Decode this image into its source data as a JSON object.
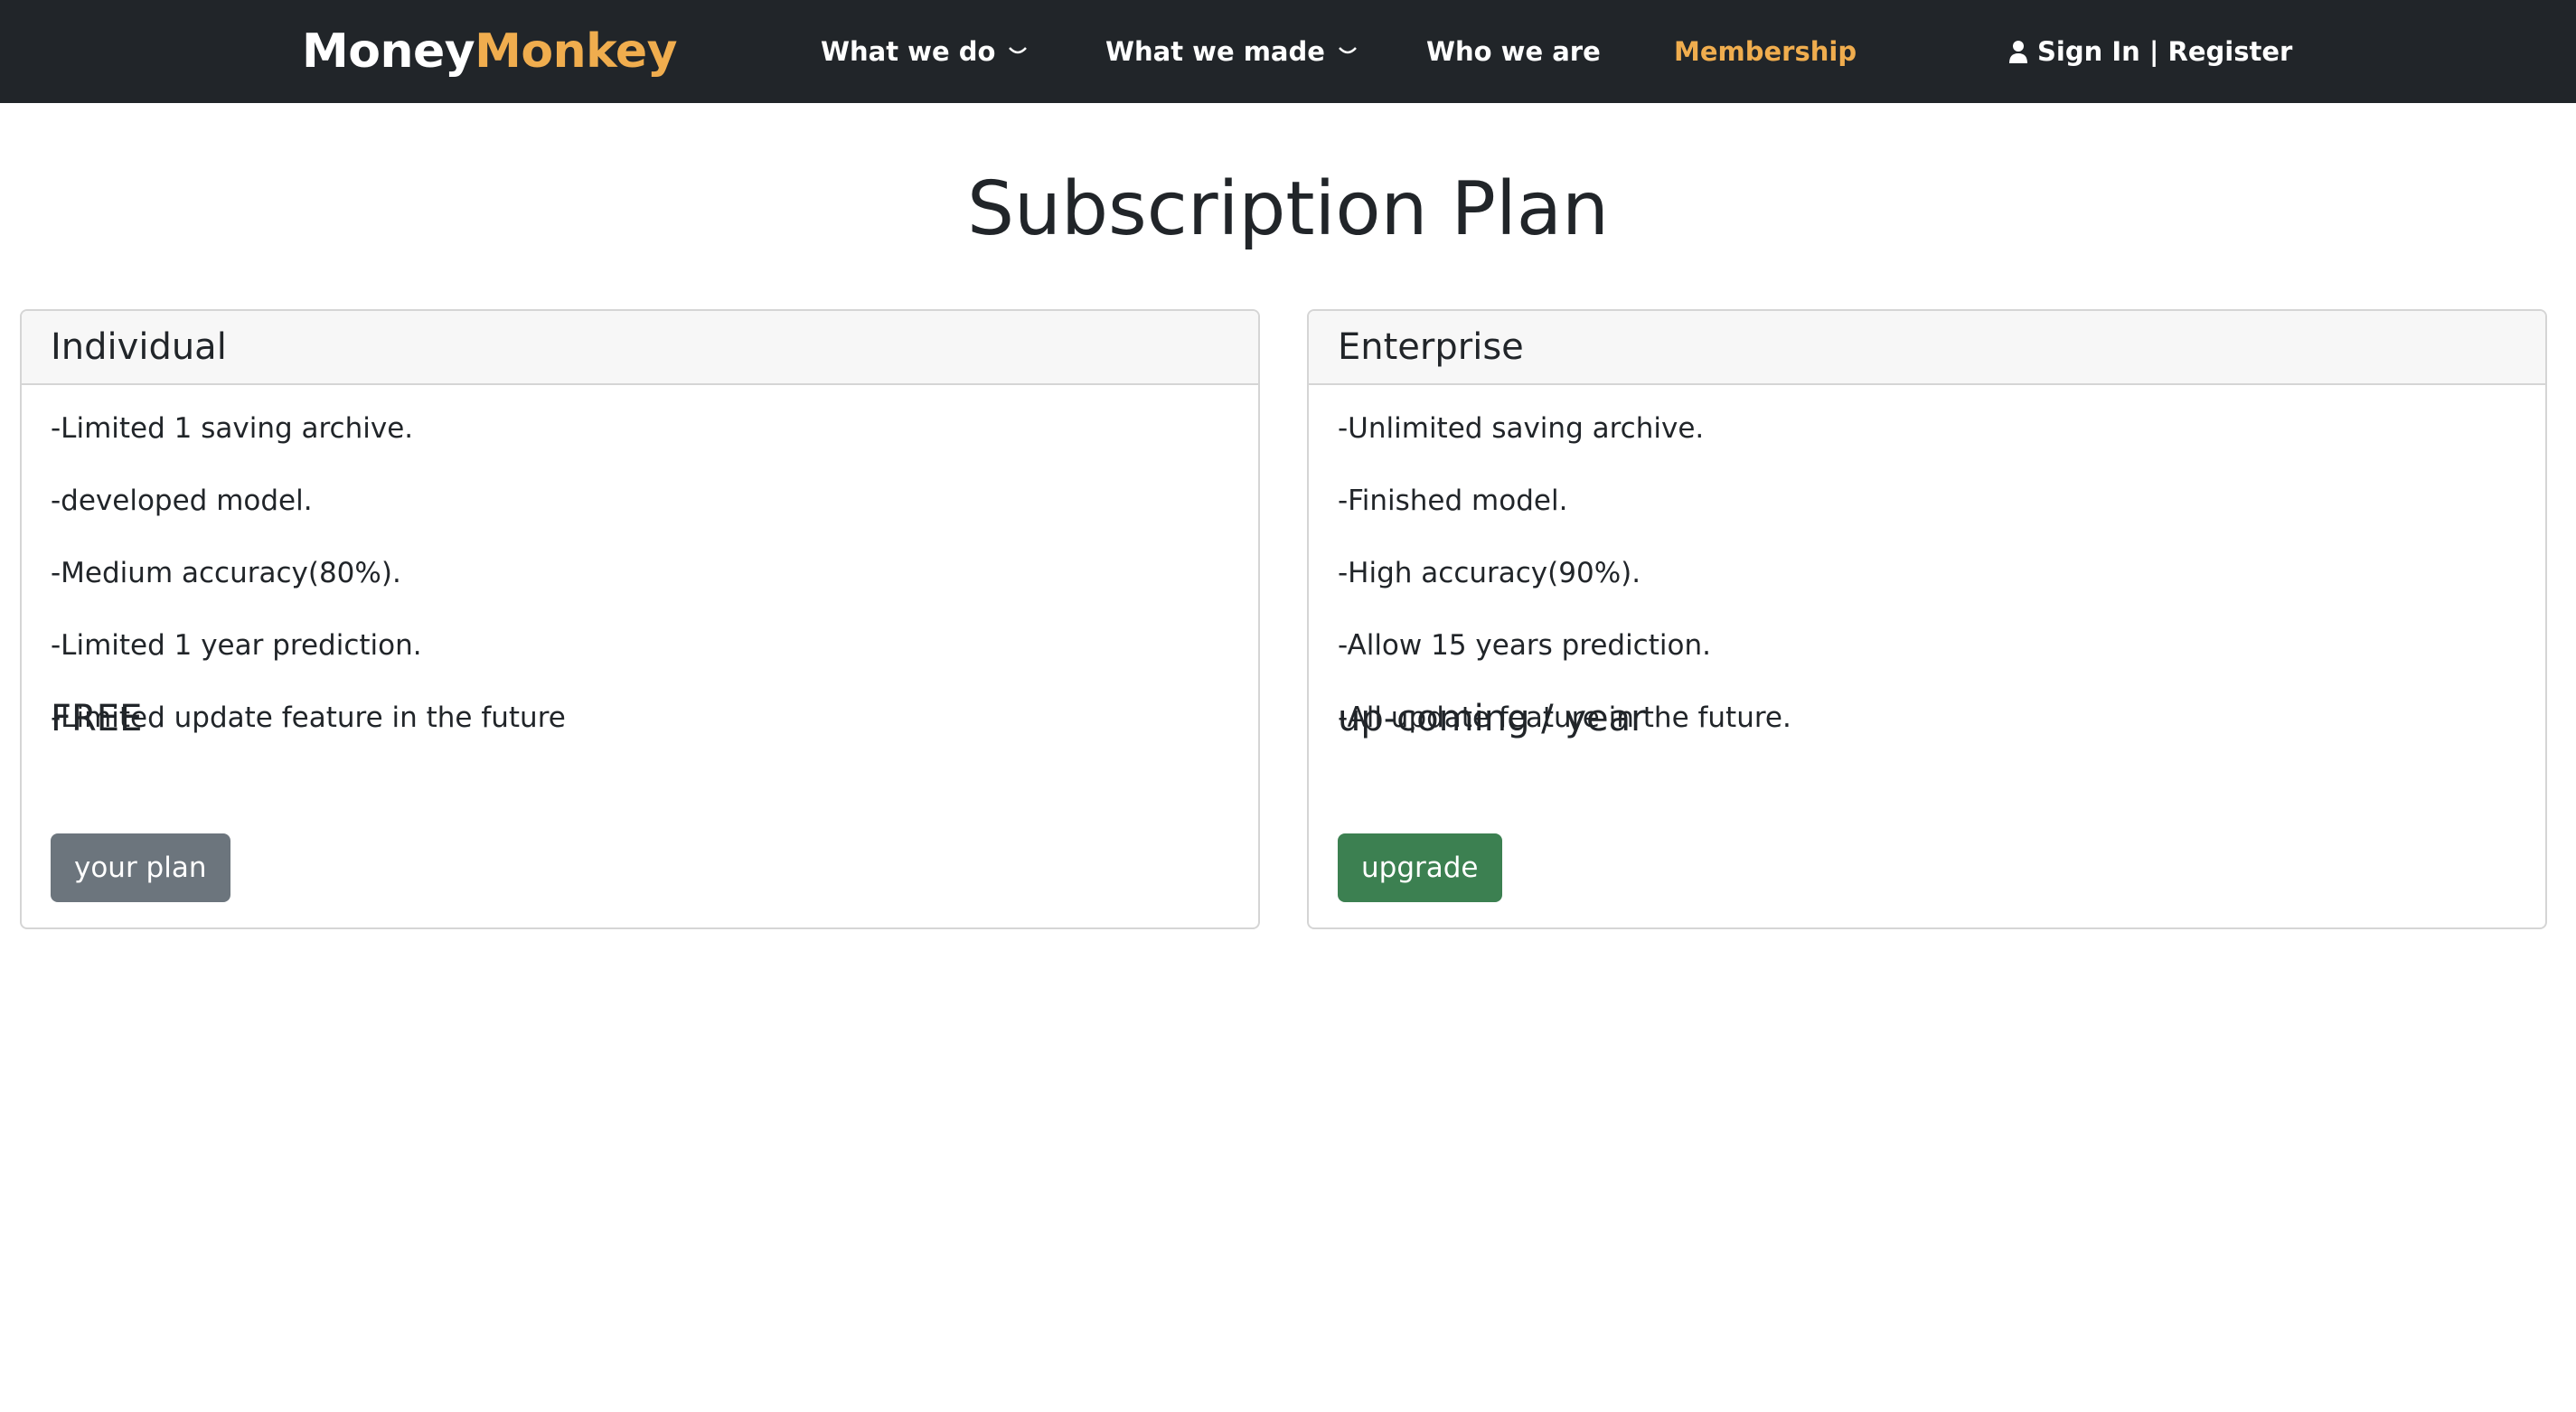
{
  "navbar": {
    "brand_part1": "Money",
    "brand_part2": "Monkey",
    "items": [
      {
        "label": "What we do"
      },
      {
        "label": "What we made"
      },
      {
        "label": "Who we are"
      },
      {
        "label": "Membership"
      }
    ],
    "signin_label": "Sign In | Register"
  },
  "page": {
    "title": "Subscription Plan"
  },
  "plans": [
    {
      "name": "Individual",
      "features": [
        "-Limited 1 saving archive.",
        "-developed model.",
        "-Medium accuracy(80%).",
        "-Limited 1 year prediction.",
        "-Limited update feature in the future"
      ],
      "price": "FREE",
      "button_label": "your plan"
    },
    {
      "name": "Enterprise",
      "features": [
        "-Unlimited saving archive.",
        "-Finished model.",
        "-High accuracy(90%).",
        "-Allow 15 years prediction.",
        "-All update feature in the future."
      ],
      "price": "up-coming / year",
      "button_label": "upgrade"
    }
  ],
  "colors": {
    "navbar_bg": "#212529",
    "accent": "#f0ad4e",
    "button_gray": "#6c757d",
    "button_green": "#3c8051"
  }
}
